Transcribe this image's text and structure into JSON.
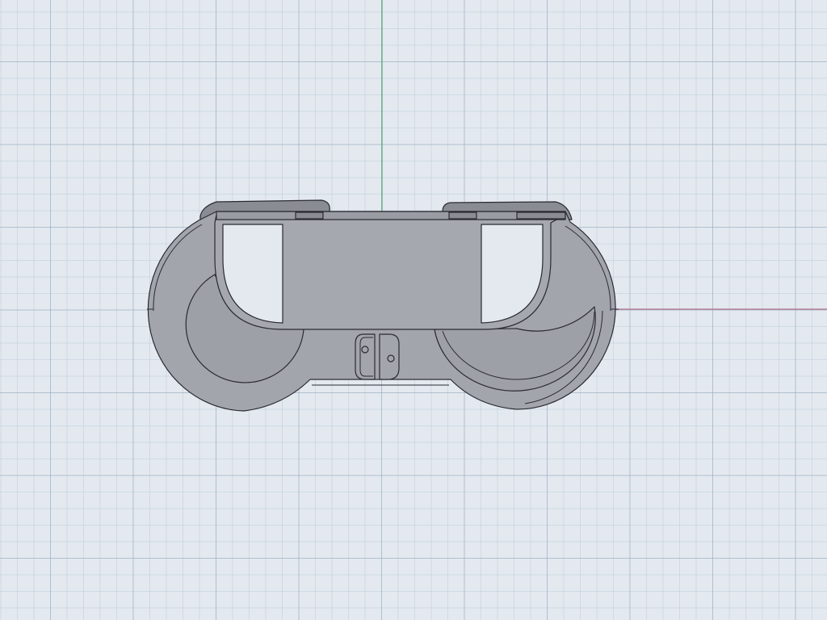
{
  "viewport": {
    "background_color": "#e3e9ef",
    "grid_color": "#a9bccd",
    "axis_y_color": "#5aa879",
    "axis_x_color": "#b0708a"
  },
  "model": {
    "name": "controller-case",
    "body_color": "#a3a5ad",
    "edge_color": "#2a2b30",
    "shade_color": "#8a8c94"
  }
}
